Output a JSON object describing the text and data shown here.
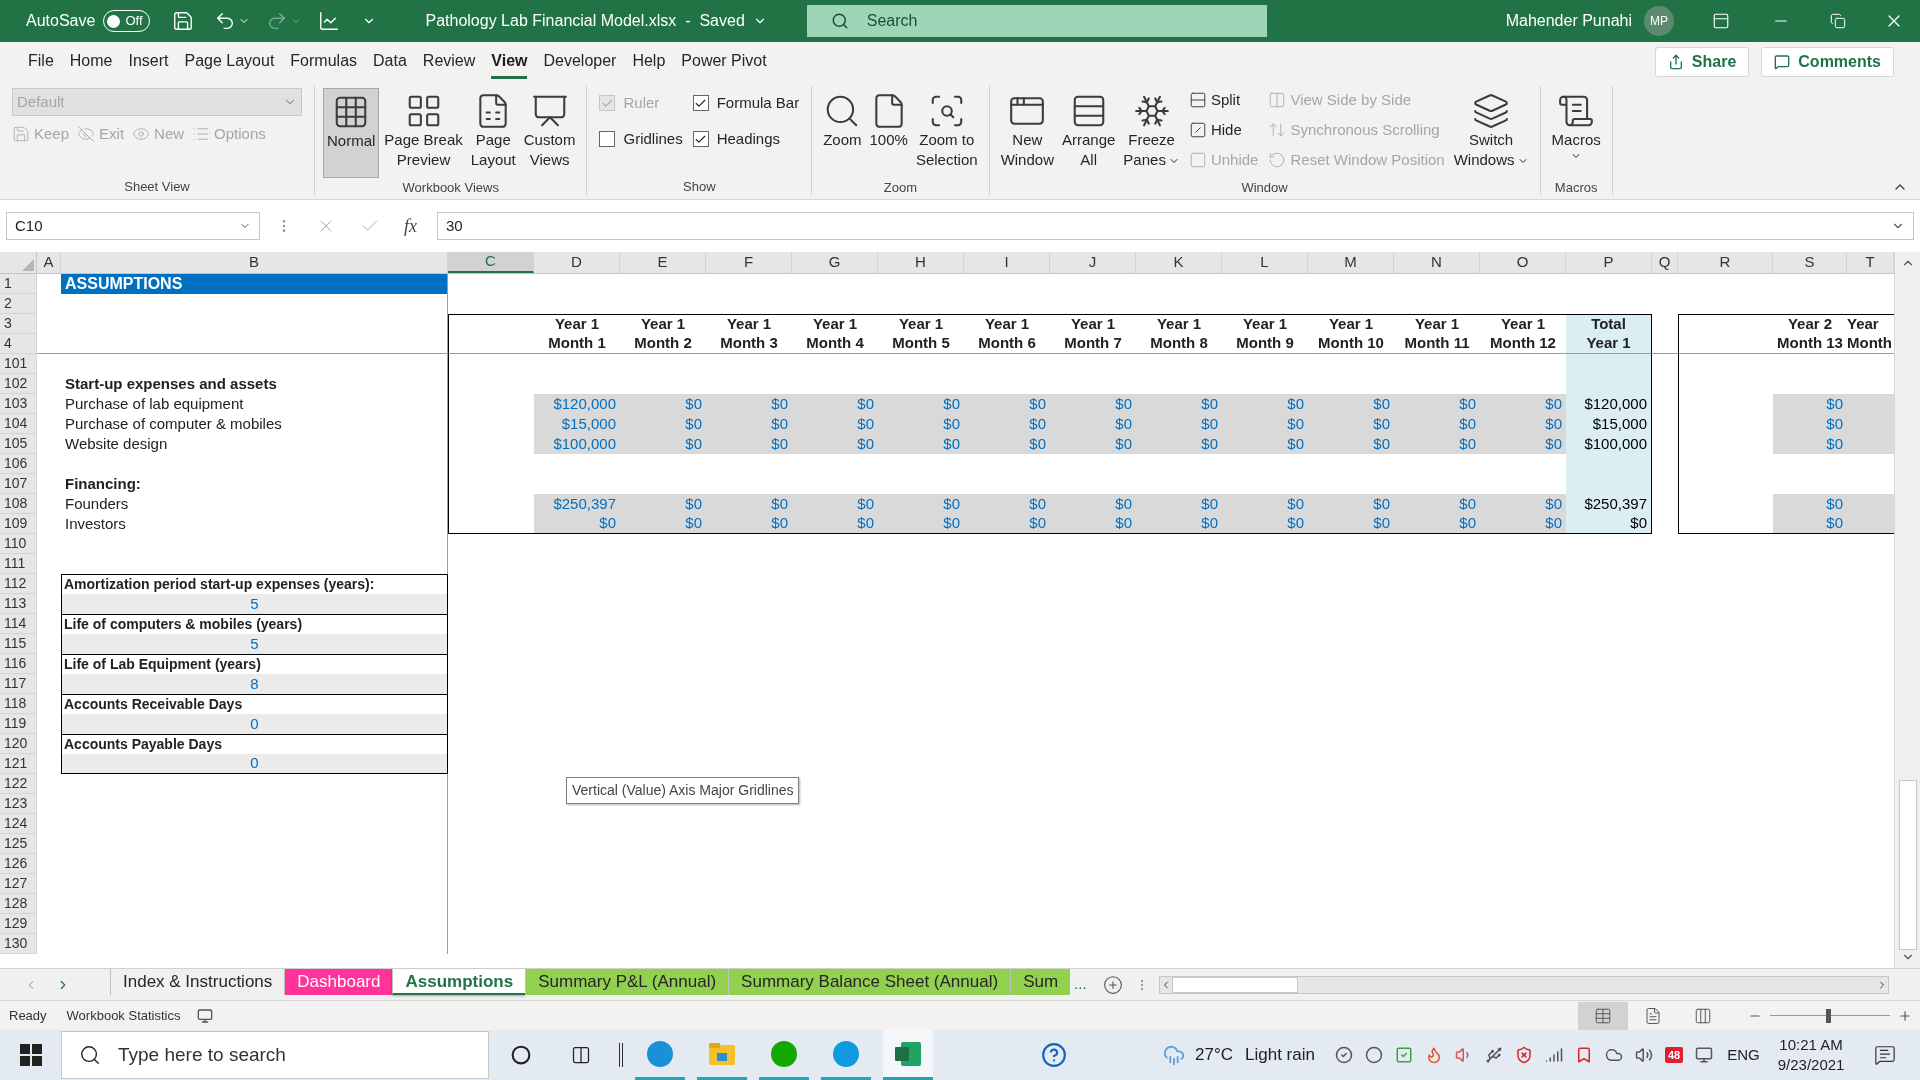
{
  "title_bar": {
    "autosave_label": "AutoSave",
    "autosave_on": false,
    "autosave_state": "Off",
    "title": "Pathology Lab Financial Model.xlsx  -  Saved",
    "search_placeholder": "Search",
    "user_name": "Mahender Punahi",
    "initials": "MP"
  },
  "menu_tabs": [
    {
      "label": "File",
      "selected": false
    },
    {
      "label": "Home",
      "selected": false
    },
    {
      "label": "Insert",
      "selected": false
    },
    {
      "label": "Page Layout",
      "selected": false
    },
    {
      "label": "Formulas",
      "selected": false
    },
    {
      "label": "Data",
      "selected": false
    },
    {
      "label": "Review",
      "selected": false
    },
    {
      "label": "View",
      "selected": true
    },
    {
      "label": "Developer",
      "selected": false
    },
    {
      "label": "Help",
      "selected": false
    },
    {
      "label": "Power Pivot",
      "selected": false
    }
  ],
  "share": "Share",
  "comments": "Comments",
  "ribbon": {
    "groups": [
      {
        "label": "Sheet View",
        "items": [
          {
            "kind": "stack",
            "items": [
              {
                "kind": "dropdown",
                "label": "Default",
                "disabled": true
              },
              {
                "kind": "row",
                "items": [
                  {
                    "kind": "small",
                    "label": "Keep",
                    "disabled": true
                  },
                  {
                    "kind": "small",
                    "label": "Exit",
                    "disabled": true
                  },
                  {
                    "kind": "small",
                    "label": "New",
                    "disabled": true
                  },
                  {
                    "kind": "small",
                    "label": "Options",
                    "disabled": true
                  }
                ]
              }
            ]
          }
        ]
      },
      {
        "label": "Workbook Views",
        "items": [
          {
            "kind": "large",
            "lines": [
              "Normal"
            ],
            "selected": true,
            "disabled": false,
            "has_menu": false
          },
          {
            "kind": "large",
            "lines": [
              "Page Break",
              "Preview"
            ],
            "selected": false,
            "disabled": false,
            "has_menu": false
          },
          {
            "kind": "large",
            "lines": [
              "Page",
              "Layout"
            ],
            "selected": false,
            "disabled": false,
            "has_menu": false
          },
          {
            "kind": "large",
            "lines": [
              "Custom",
              "Views"
            ],
            "selected": false,
            "disabled": false,
            "has_menu": false
          }
        ]
      },
      {
        "label": "Show",
        "items": [
          {
            "kind": "stack",
            "items": [
              {
                "kind": "checkbox",
                "label": "Ruler",
                "checked": true,
                "disabled": true
              },
              {
                "kind": "checkbox",
                "label": "Gridlines",
                "checked": false,
                "disabled": false
              }
            ]
          },
          {
            "kind": "stack",
            "items": [
              {
                "kind": "checkbox",
                "label": "Formula Bar",
                "checked": true,
                "disabled": false
              },
              {
                "kind": "checkbox",
                "label": "Headings",
                "checked": true,
                "disabled": false
              }
            ]
          }
        ]
      },
      {
        "label": "Zoom",
        "items": [
          {
            "kind": "large",
            "lines": [
              "Zoom"
            ],
            "disabled": false,
            "has_menu": false
          },
          {
            "kind": "large",
            "lines": [
              "100%"
            ],
            "disabled": false,
            "has_menu": false
          },
          {
            "kind": "large",
            "lines": [
              "Zoom to",
              "Selection"
            ],
            "disabled": false,
            "has_menu": false
          }
        ]
      },
      {
        "label": "Window",
        "items": [
          {
            "kind": "large",
            "lines": [
              "New",
              "Window"
            ],
            "disabled": false,
            "has_menu": false
          },
          {
            "kind": "large",
            "lines": [
              "Arrange",
              "All"
            ],
            "disabled": false,
            "has_menu": false
          },
          {
            "kind": "large",
            "lines": [
              "Freeze",
              "Panes"
            ],
            "disabled": false,
            "has_menu": true
          },
          {
            "kind": "stack",
            "items": [
              {
                "kind": "small",
                "label": "Split",
                "disabled": false
              },
              {
                "kind": "small",
                "label": "Hide",
                "disabled": false
              },
              {
                "kind": "small",
                "label": "Unhide",
                "disabled": true
              }
            ]
          },
          {
            "kind": "stack",
            "items": [
              {
                "kind": "small",
                "label": "View Side by Side",
                "disabled": true
              },
              {
                "kind": "small",
                "label": "Synchronous Scrolling",
                "disabled": true
              },
              {
                "kind": "small",
                "label": "Reset Window Position",
                "disabled": true
              }
            ]
          },
          {
            "kind": "large",
            "lines": [
              "Switch",
              "Windows"
            ],
            "disabled": false,
            "has_menu": true
          }
        ]
      },
      {
        "label": "Macros",
        "items": [
          {
            "kind": "large",
            "lines": [
              "Macros"
            ],
            "disabled": false,
            "has_menu": true
          }
        ]
      }
    ]
  },
  "formula_bar": {
    "name_box": "C10",
    "fx": "fx",
    "value": "30"
  },
  "sheet": {
    "columns": [
      {
        "letter": "A",
        "selected": false
      },
      {
        "letter": "B",
        "selected": false
      },
      {
        "letter": "C",
        "selected": true
      },
      {
        "letter": "D",
        "selected": false
      },
      {
        "letter": "E",
        "selected": false
      },
      {
        "letter": "F",
        "selected": false
      },
      {
        "letter": "G",
        "selected": false
      },
      {
        "letter": "H",
        "selected": false
      },
      {
        "letter": "I",
        "selected": false
      },
      {
        "letter": "J",
        "selected": false
      },
      {
        "letter": "K",
        "selected": false
      },
      {
        "letter": "L",
        "selected": false
      },
      {
        "letter": "M",
        "selected": false
      },
      {
        "letter": "N",
        "selected": false
      },
      {
        "letter": "O",
        "selected": false
      },
      {
        "letter": "P",
        "selected": false
      },
      {
        "letter": "Q",
        "selected": false
      },
      {
        "letter": "R",
        "selected": false
      },
      {
        "letter": "S",
        "selected": false
      },
      {
        "letter": "T",
        "selected": false
      }
    ],
    "rows": [
      {
        "num": "1",
        "kind": "title",
        "label": "ASSUMPTIONS"
      },
      {
        "num": "2",
        "kind": "blank"
      },
      {
        "num": "3",
        "kind": "header",
        "months": [
          "Year 1",
          "Year 1",
          "Year 1",
          "Year 1",
          "Year 1",
          "Year 1",
          "Year 1",
          "Year 1",
          "Year 1",
          "Year 1",
          "Year 1",
          "Year 1"
        ],
        "total": "Total",
        "year2": "Year 2",
        "next": "Year"
      },
      {
        "num": "4",
        "kind": "header",
        "months": [
          "Month 1",
          "Month 2",
          "Month 3",
          "Month 4",
          "Month 5",
          "Month 6",
          "Month 7",
          "Month 8",
          "Month 9",
          "Month 10",
          "Month 11",
          "Month 12"
        ],
        "total": "Year 1",
        "year2": "Month 13",
        "next": "Month"
      },
      {
        "num": "101",
        "kind": "blank"
      },
      {
        "num": "102",
        "kind": "section",
        "label": "Start-up expenses and assets"
      },
      {
        "num": "103",
        "kind": "data",
        "label": "Purchase of lab equipment",
        "months": [
          "$120,000",
          "$0",
          "$0",
          "$0",
          "$0",
          "$0",
          "$0",
          "$0",
          "$0",
          "$0",
          "$0",
          "$0"
        ],
        "total": "$120,000",
        "year2": "$0"
      },
      {
        "num": "104",
        "kind": "data",
        "label": "Purchase of computer & mobiles",
        "months": [
          "$15,000",
          "$0",
          "$0",
          "$0",
          "$0",
          "$0",
          "$0",
          "$0",
          "$0",
          "$0",
          "$0",
          "$0"
        ],
        "total": "$15,000",
        "year2": "$0"
      },
      {
        "num": "105",
        "kind": "data",
        "label": "Website design",
        "months": [
          "$100,000",
          "$0",
          "$0",
          "$0",
          "$0",
          "$0",
          "$0",
          "$0",
          "$0",
          "$0",
          "$0",
          "$0"
        ],
        "total": "$100,000",
        "year2": "$0"
      },
      {
        "num": "106",
        "kind": "blank"
      },
      {
        "num": "107",
        "kind": "section",
        "label": "Financing:"
      },
      {
        "num": "108",
        "kind": "data",
        "label": "Founders",
        "months": [
          "$250,397",
          "$0",
          "$0",
          "$0",
          "$0",
          "$0",
          "$0",
          "$0",
          "$0",
          "$0",
          "$0",
          "$0"
        ],
        "total": "$250,397",
        "year2": "$0"
      },
      {
        "num": "109",
        "kind": "data",
        "label": "Investors",
        "months": [
          "$0",
          "$0",
          "$0",
          "$0",
          "$0",
          "$0",
          "$0",
          "$0",
          "$0",
          "$0",
          "$0",
          "$0"
        ],
        "total": "$0",
        "year2": "$0"
      },
      {
        "num": "110",
        "kind": "blank"
      },
      {
        "num": "111",
        "kind": "blank"
      },
      {
        "num": "112",
        "kind": "input_label",
        "label": "Amortization period start-up expenses (years):"
      },
      {
        "num": "113",
        "kind": "input_value",
        "value": "5"
      },
      {
        "num": "114",
        "kind": "input_label",
        "label": "Life of computers & mobiles (years)"
      },
      {
        "num": "115",
        "kind": "input_value",
        "value": "5"
      },
      {
        "num": "116",
        "kind": "input_label",
        "label": "Life of  Lab Equipment (years)"
      },
      {
        "num": "117",
        "kind": "input_value",
        "value": "8"
      },
      {
        "num": "118",
        "kind": "input_label",
        "label": "Accounts Receivable Days"
      },
      {
        "num": "119",
        "kind": "input_value",
        "value": "0"
      },
      {
        "num": "120",
        "kind": "input_label",
        "label": "Accounts Payable Days"
      },
      {
        "num": "121",
        "kind": "input_value",
        "value": "0"
      },
      {
        "num": "122",
        "kind": "blank"
      },
      {
        "num": "123",
        "kind": "blank"
      },
      {
        "num": "124",
        "kind": "blank"
      },
      {
        "num": "125",
        "kind": "blank"
      },
      {
        "num": "126",
        "kind": "blank"
      },
      {
        "num": "127",
        "kind": "blank"
      },
      {
        "num": "128",
        "kind": "blank"
      },
      {
        "num": "129",
        "kind": "blank"
      },
      {
        "num": "130",
        "kind": "blank"
      }
    ]
  },
  "tooltip": "Vertical (Value) Axis Major Gridlines",
  "sheet_tabs": [
    {
      "label": "Index & Instructions",
      "selected": false
    },
    {
      "label": "Dashboard",
      "selected": false,
      "color": "#ff3399"
    },
    {
      "label": "Assumptions",
      "selected": true
    },
    {
      "label": "Summary P&L (Annual)",
      "selected": false,
      "color": "#92d050"
    },
    {
      "label": "Summary Balance Sheet (Annual)",
      "selected": false,
      "color": "#92d050"
    },
    {
      "label": "Sum",
      "selected": false,
      "color": "#92d050"
    }
  ],
  "more_tabs": "...",
  "status_bar": {
    "ready": "Ready",
    "stats": "Workbook Statistics",
    "views": [
      {
        "selected": true
      },
      {
        "selected": false
      },
      {
        "selected": false
      }
    ],
    "zoom_slider": {
      "level": 0.48
    }
  },
  "taskbar": {
    "search_placeholder": "Type here to search",
    "temperature": "27°C",
    "weather": "Light rain",
    "badge": "48",
    "language": "ENG",
    "time": "10:21 AM",
    "date": "9/23/2021"
  }
}
